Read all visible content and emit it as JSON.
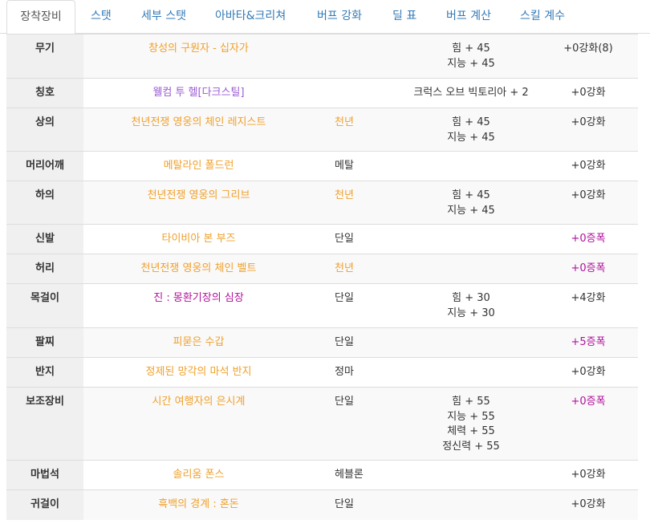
{
  "tabs": [
    "장착장비",
    "스탯",
    "세부 스탯",
    "아바타&크리쳐",
    "버프 강화",
    "딜 표",
    "버프 계산",
    "스킬 계수"
  ],
  "colors": {
    "legendary": "#f0a02a",
    "epic": "#9b59d6",
    "mythic": "#b0129b",
    "text": "#333333",
    "tab_link": "#337ab7"
  },
  "rows": [
    {
      "slot": "무기",
      "name": "창성의 구원자 - 십자가",
      "rarity": "legendary",
      "set": "",
      "set_rarity": "",
      "stats": [
        "힘 + 45",
        "지능 + 45"
      ],
      "enhance": "+0강화(8)",
      "enhance_color": "dark",
      "height": 55
    },
    {
      "slot": "칭호",
      "name": "웰컴 투 헬[다크스틸]",
      "rarity": "epic",
      "set": "",
      "set_rarity": "",
      "stats": [
        "크럭스 오브 빅토리아 + 2"
      ],
      "enhance": "+0강화",
      "enhance_color": "dark",
      "height": 37
    },
    {
      "slot": "상의",
      "name": "천년전쟁 영웅의 체인 레지스트",
      "rarity": "legendary",
      "set": "천년",
      "set_rarity": "legendary",
      "stats": [
        "힘 + 45",
        "지능 + 45"
      ],
      "enhance": "+0강화",
      "enhance_color": "dark",
      "height": 54
    },
    {
      "slot": "머리어깨",
      "name": "메탈라인 폴드런",
      "rarity": "legendary",
      "set": "메탈",
      "set_rarity": "dark",
      "stats": [],
      "enhance": "+0강화",
      "enhance_color": "dark",
      "height": 37
    },
    {
      "slot": "하의",
      "name": "천년전쟁 영웅의 그리브",
      "rarity": "legendary",
      "set": "천년",
      "set_rarity": "legendary",
      "stats": [
        "힘 + 45",
        "지능 + 45"
      ],
      "enhance": "+0강화",
      "enhance_color": "dark",
      "height": 54
    },
    {
      "slot": "신발",
      "name": "타이비아 본 부즈",
      "rarity": "legendary",
      "set": "단일",
      "set_rarity": "dark",
      "stats": [],
      "enhance": "+0증폭",
      "enhance_color": "mythic",
      "height": 37
    },
    {
      "slot": "허리",
      "name": "천년전쟁 영웅의 체인 벨트",
      "rarity": "legendary",
      "set": "천년",
      "set_rarity": "legendary",
      "stats": [],
      "enhance": "+0증폭",
      "enhance_color": "mythic",
      "height": 37
    },
    {
      "slot": "목걸이",
      "name": "진 : 몽환기장의 심장",
      "rarity": "mythic",
      "set": "단일",
      "set_rarity": "dark",
      "stats": [
        "힘 + 30",
        "지능 + 30"
      ],
      "enhance": "+4강화",
      "enhance_color": "dark",
      "height": 55
    },
    {
      "slot": "팔찌",
      "name": "피묻은 수갑",
      "rarity": "legendary",
      "set": "단일",
      "set_rarity": "dark",
      "stats": [],
      "enhance": "+5증폭",
      "enhance_color": "mythic",
      "height": 37
    },
    {
      "slot": "반지",
      "name": "정제된 망각의 마석 반지",
      "rarity": "legendary",
      "set": "정마",
      "set_rarity": "dark",
      "stats": [],
      "enhance": "+0강화",
      "enhance_color": "dark",
      "height": 37
    },
    {
      "slot": "보조장비",
      "name": "시간 여행자의 은시계",
      "rarity": "legendary",
      "set": "단일",
      "set_rarity": "dark",
      "stats": [
        "힘 + 55",
        "지능 + 55",
        "체력 + 55",
        "정신력 + 55"
      ],
      "enhance": "+0증폭",
      "enhance_color": "mythic",
      "height": 91
    },
    {
      "slot": "마법석",
      "name": "솔리움 폰스",
      "rarity": "legendary",
      "set": "헤블론",
      "set_rarity": "dark",
      "stats": [],
      "enhance": "+0강화",
      "enhance_color": "dark",
      "height": 37
    },
    {
      "slot": "귀걸이",
      "name": "흑백의 경계 : 혼돈",
      "rarity": "legendary",
      "set": "단일",
      "set_rarity": "dark",
      "stats": [],
      "enhance": "+0강화",
      "enhance_color": "dark",
      "height": 37
    }
  ]
}
